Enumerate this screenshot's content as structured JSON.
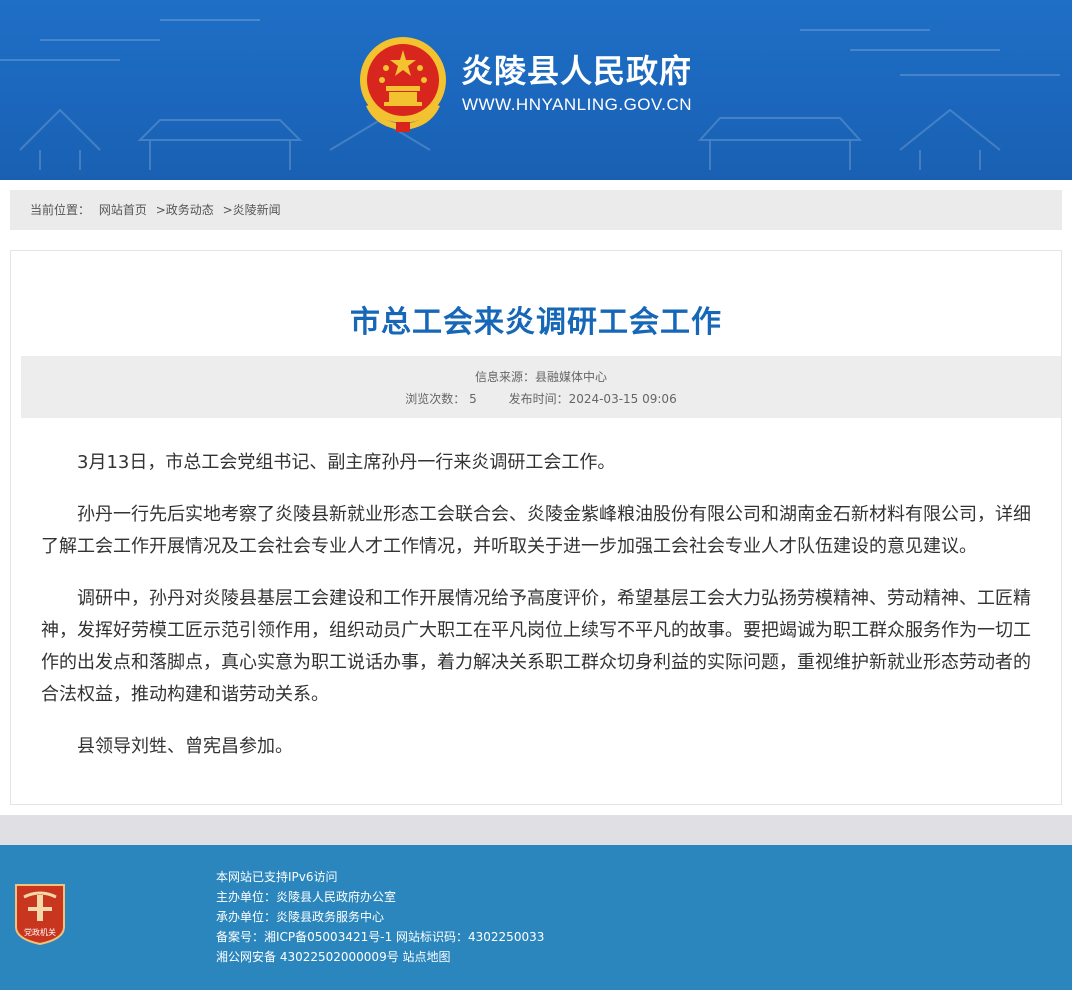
{
  "header": {
    "site_title": "炎陵县人民政府",
    "site_url": "WWW.HNYANLING.GOV.CN",
    "background_color": "#1b67bd",
    "emblem_icon": "national-emblem-icon"
  },
  "breadcrumb": {
    "prefix": "当前位置：",
    "items": [
      {
        "label": "网站首页"
      },
      {
        "label": ">政务动态"
      },
      {
        "label": ">炎陵新闻"
      }
    ]
  },
  "article": {
    "title": "市总工会来炎调研工会工作",
    "title_color": "#1667b7",
    "source": "信息来源：县融媒体中心",
    "views": "浏览次数：  5",
    "published": "发布时间：2024-03-15 09:06",
    "paragraphs": [
      "3月13日，市总工会党组书记、副主席孙丹一行来炎调研工会工作。",
      "孙丹一行先后实地考察了炎陵县新就业形态工会联合会、炎陵金紫峰粮油股份有限公司和湖南金石新材料有限公司，详细了解工会工作开展情况及工会社会专业人才工作情况，并听取关于进一步加强工会社会专业人才队伍建设的意见建议。",
      "调研中，孙丹对炎陵县基层工会建设和工作开展情况给予高度评价，希望基层工会大力弘扬劳模精神、劳动精神、工匠精神，发挥好劳模工匠示范引领作用，组织动员广大职工在平凡岗位上续写不平凡的故事。要把竭诚为职工群众服务作为一切工作的出发点和落脚点，真心实意为职工说话办事，着力解决关系职工群众切身利益的实际问题，重视维护新就业形态劳动者的合法权益，推动构建和谐劳动关系。",
      "县领导刘甡、曾宪昌参加。"
    ]
  },
  "footer": {
    "background_color": "#2a86bd",
    "badge_icon": "party-organ-badge-icon",
    "badge_text": "党政机关",
    "ipv6": "本网站已支持IPv6访问",
    "host": "主办单位：炎陵县人民政府办公室",
    "organizer": "承办单位：炎陵县政务服务中心",
    "icp": "备案号：湘ICP备05003421号-1 网站标识码：4302250033",
    "police": "湘公网安备 43022502000009号",
    "sitemap": "站点地图"
  }
}
